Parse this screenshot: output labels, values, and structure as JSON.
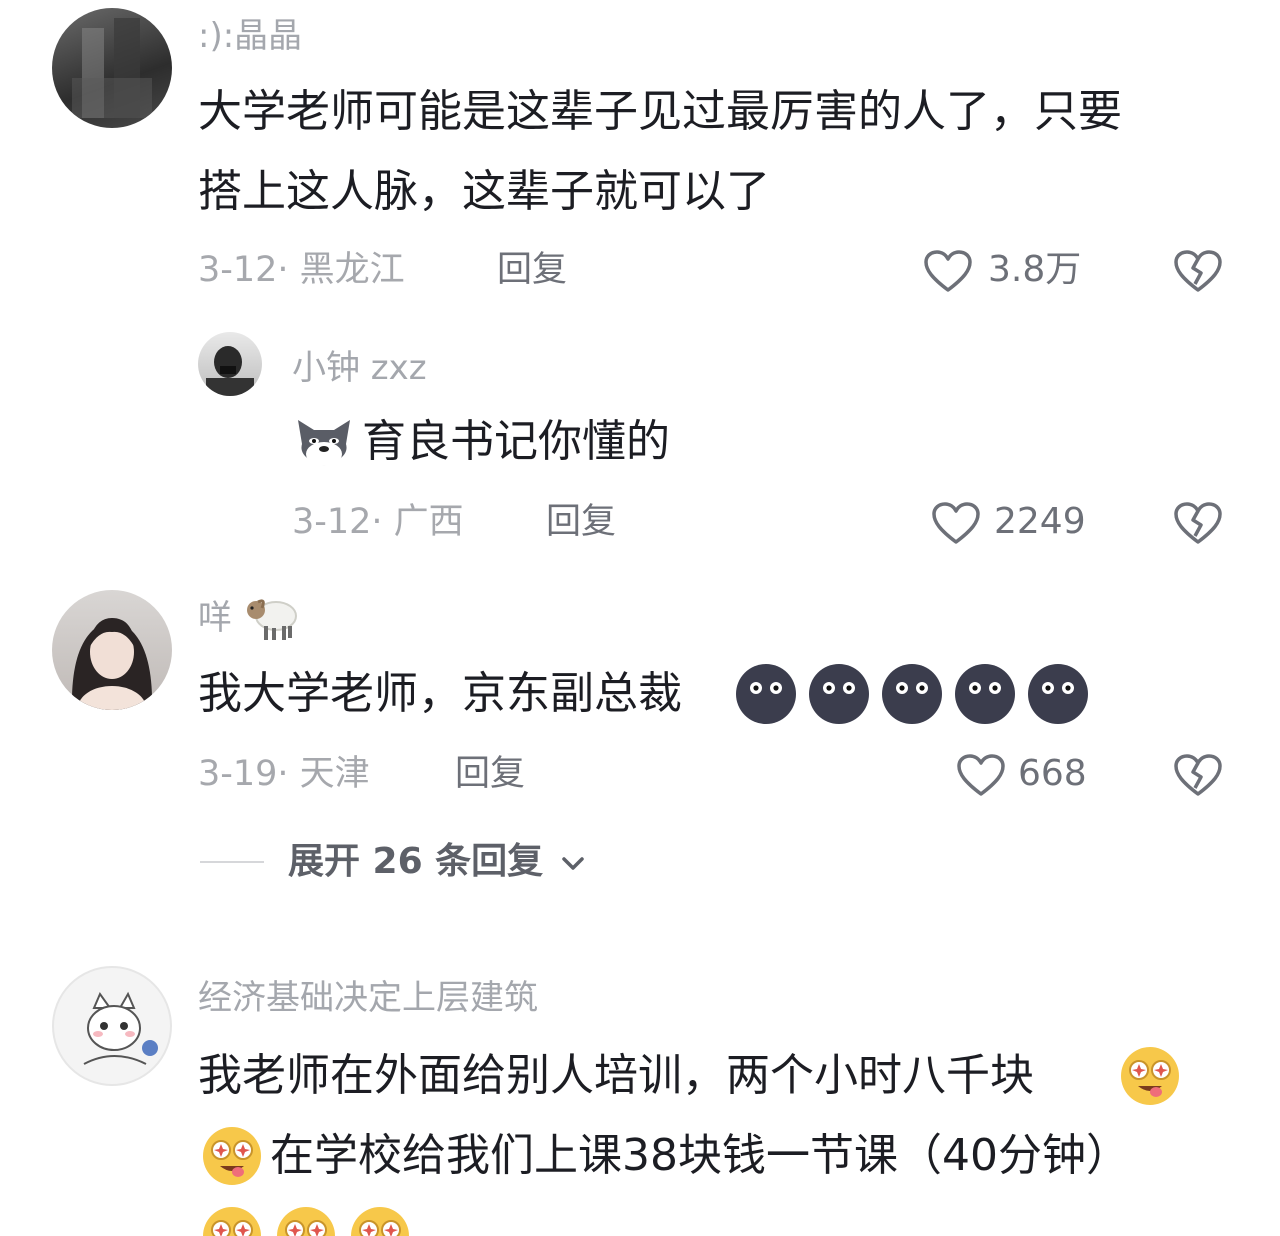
{
  "comments": [
    {
      "username": ":):晶晶",
      "text_line1": "大学老师可能是这辈子见过最厉害的人了，只要",
      "text_line2": "搭上这人脉，这辈子就可以了",
      "meta": "3-12· 黑龙江",
      "reply_label": "回复",
      "likes": "3.8万"
    },
    {
      "username": "小钟 zxz",
      "text": "育良书记你懂的",
      "meta": "3-12· 广西",
      "reply_label": "回复",
      "likes": "2249"
    },
    {
      "username": "咩",
      "text": "我大学老师，京东副总裁",
      "meta": "3-19· 天津",
      "reply_label": "回复",
      "likes": "668",
      "expand_label": "展开 26 条回复"
    },
    {
      "username": "经济基础决定上层建筑",
      "text_line1": "我老师在外面给别人培训，两个小时八千块",
      "text_line2": "在学校给我们上课38块钱一节课（40分钟）"
    }
  ],
  "icons": {
    "like": "heart-outline-icon",
    "dislike": "broken-heart-icon",
    "expand": "chevron-down-icon",
    "dark_emoji": "dark-face-emoji",
    "drool_emoji": "drooling-face-emoji",
    "wolf_emoji": "wolf-face-emoji",
    "sheep_emoji": "sheep-emoji"
  }
}
